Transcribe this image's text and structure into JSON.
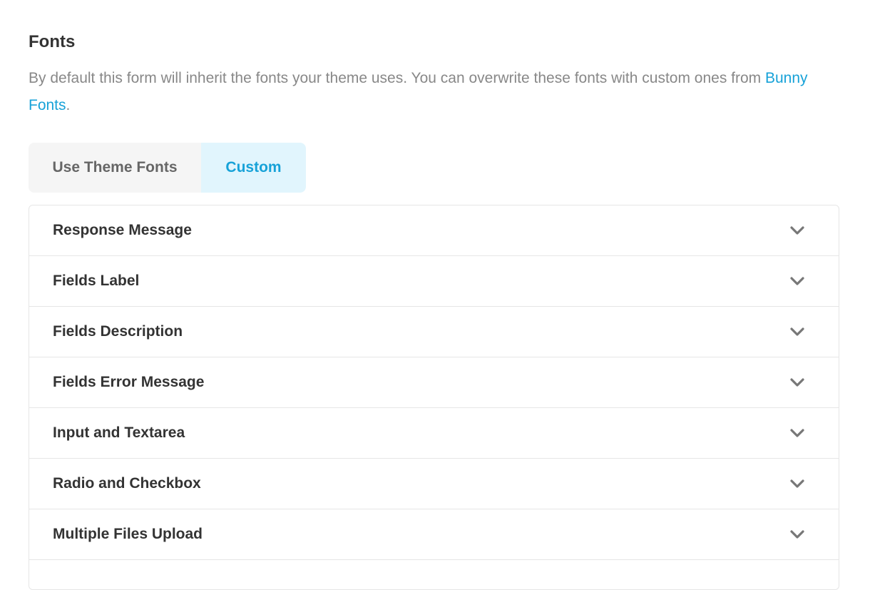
{
  "fonts_section": {
    "title": "Fonts",
    "description": "By default this form will inherit the fonts your theme uses. You can overwrite these fonts with custom ones from ",
    "link_text": "Bunny Fonts",
    "description_end": "."
  },
  "font_mode": {
    "options": [
      {
        "label": "Use Theme Fonts",
        "selected": false
      },
      {
        "label": "Custom",
        "selected": true
      }
    ]
  },
  "accordion": {
    "items": [
      {
        "label": "Response Message"
      },
      {
        "label": "Fields Label"
      },
      {
        "label": "Fields Description"
      },
      {
        "label": "Fields Error Message"
      },
      {
        "label": "Input and Textarea"
      },
      {
        "label": "Radio and Checkbox"
      },
      {
        "label": "Multiple Files Upload"
      }
    ],
    "icon": "chevron-down-icon"
  },
  "colors": {
    "accent": "#17a2d8",
    "accent_bg": "#e1f5fd",
    "text": "#333333",
    "muted": "#888888"
  }
}
